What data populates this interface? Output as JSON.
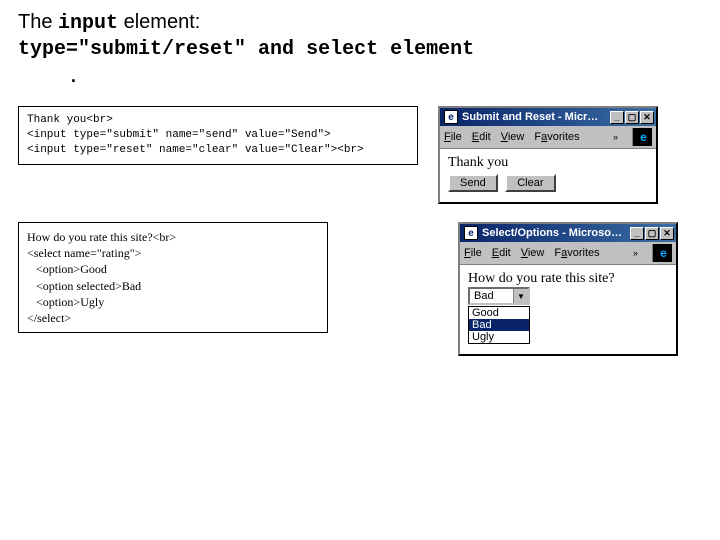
{
  "heading": {
    "line1_prefix": "The ",
    "line1_code": "input",
    "line1_suffix": " element:",
    "line2_code1": "type=\"submit/reset\"",
    "line2_mid": " and ",
    "line2_code2": "select element",
    "dot": "."
  },
  "code1": {
    "l1": "Thank you<br>",
    "l2": "<input type=\"submit\" name=\"send\" value=\"Send\">",
    "l3": "<input type=\"reset\" name=\"clear\" value=\"Clear\"><br>"
  },
  "code2": {
    "l1": "How do you rate this site?<br>",
    "l2": "<select name=\"rating\">",
    "l3": "   <option>Good",
    "l4": "   <option selected>Bad",
    "l5": "   <option>Ugly",
    "l6": "</select>"
  },
  "win1": {
    "title": "Submit and Reset - Micr…",
    "menu_file": "File",
    "menu_edit": "Edit",
    "menu_view": "View",
    "menu_fav": "Favorites",
    "chev": "»",
    "body_text": "Thank you",
    "btn_send": "Send",
    "btn_clear": "Clear"
  },
  "win2": {
    "title": "Select/Options - Microso…",
    "menu_file": "File",
    "menu_edit": "Edit",
    "menu_view": "View",
    "menu_fav": "Favorites",
    "chev": "»",
    "body_text": "How do you rate this site?",
    "selected": "Bad",
    "opts": {
      "o1": "Good",
      "o2": "Bad",
      "o3": "Ugly"
    }
  },
  "icons": {
    "ie": "e",
    "min": "_",
    "max": "▢",
    "close": "✕",
    "down": "▼"
  }
}
